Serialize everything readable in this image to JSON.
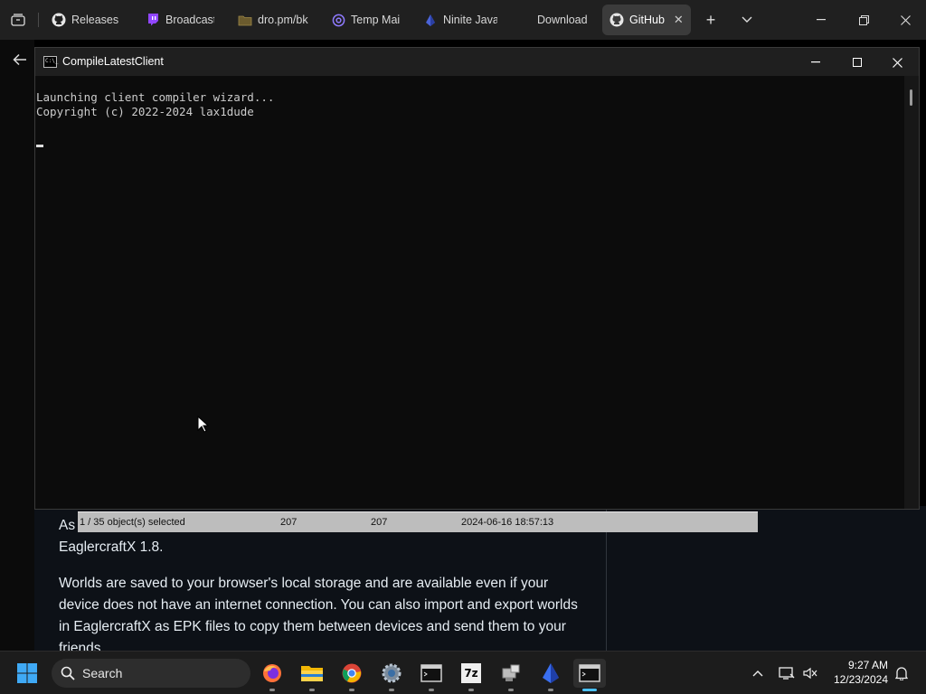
{
  "browser": {
    "tabs": [
      {
        "label": "Releases · ",
        "icon": "github-icon"
      },
      {
        "label": "Broadcast",
        "icon": "twitch-icon"
      },
      {
        "label": "dro.pm/bk",
        "icon": "folder-icon"
      },
      {
        "label": "Temp Mai",
        "icon": "at-sign-icon"
      },
      {
        "label": "Ninite Java",
        "icon": "ninite-icon"
      },
      {
        "label": "Download",
        "icon": ""
      },
      {
        "label": "GitHub",
        "icon": "github-icon",
        "active": true
      }
    ],
    "new_tab_glyph": "+",
    "tab_list_glyph": "⌄",
    "back_glyph": "←"
  },
  "console": {
    "title": "CompileLatestClient",
    "icon_text": "C:\\_",
    "lines": [
      "Launching client compiler wizard...",
      "Copyright (c) 2022-2024 lax1dude"
    ]
  },
  "webpage": {
    "paragraph1": "As                                                    EaglercraftX 1.8.",
    "paragraph1_line2": "EaglercraftX 1.8.",
    "paragraph1_line1": "As",
    "paragraph2": "Worlds are saved to your browser's local storage and are available even if your device does not have an internet connection. You can also import and export worlds in EaglercraftX as EPK files to copy them between devices and send them to your friends."
  },
  "statusbar": {
    "selected": "1 / 35 object(s) selected",
    "size1": "207",
    "size2": "207",
    "date": "2024-06-16 18:57:13"
  },
  "taskbar": {
    "search_label": "Search",
    "apps": [
      "firefox-icon",
      "file-explorer-icon",
      "chrome-icon",
      "settings-icon",
      "terminal-icon",
      "7zip-icon",
      "network-tool-icon",
      "app-icon",
      "console-app-icon"
    ],
    "seven_zip_label": "7z",
    "tray_up_glyph": "^",
    "time": "9:27 AM",
    "date": "12/23/2024"
  }
}
